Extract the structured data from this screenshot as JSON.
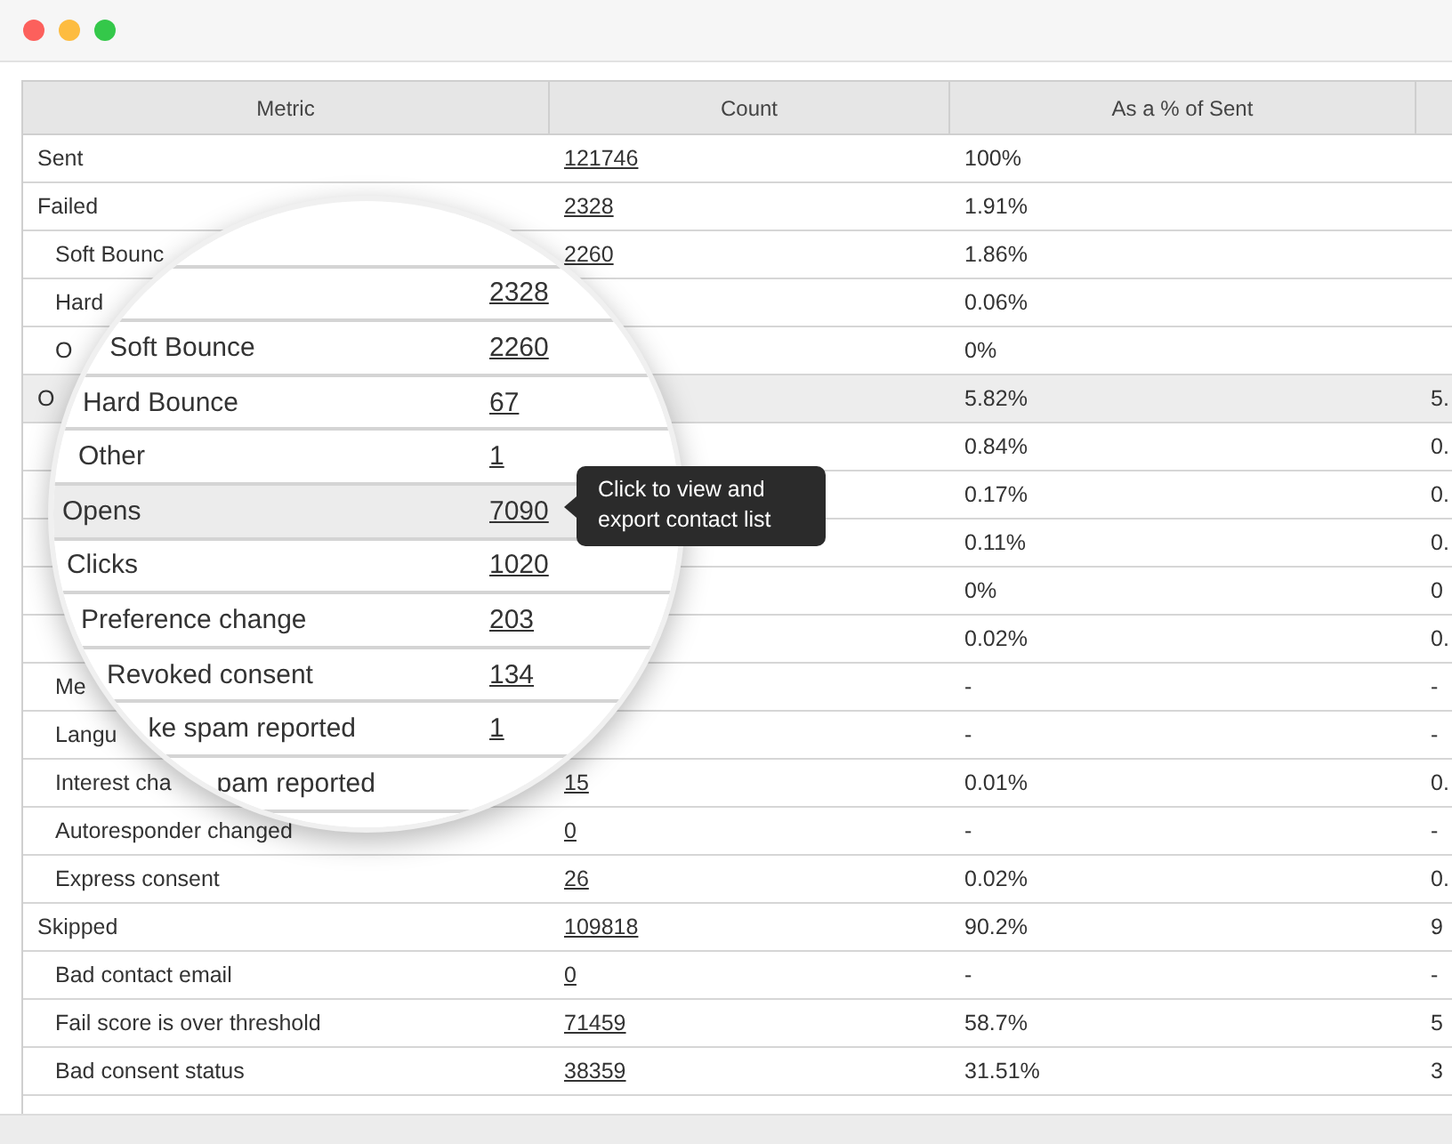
{
  "table": {
    "columns": [
      "Metric",
      "Count",
      "As a % of Sent"
    ],
    "rows": [
      {
        "kind": "group",
        "highlighted": false,
        "metric": "Sent",
        "count": "121746",
        "percent": "100%"
      },
      {
        "kind": "group",
        "highlighted": false,
        "metric": "Failed",
        "count": "2328",
        "percent": "1.91%"
      },
      {
        "kind": "sub",
        "highlighted": false,
        "metric": "Soft Bounc",
        "count": "2260",
        "percent": "1.86%"
      },
      {
        "kind": "sub",
        "highlighted": false,
        "metric": "Hard",
        "percent": "0.06%"
      },
      {
        "kind": "sub",
        "highlighted": false,
        "metric": "O",
        "percent": "0%"
      },
      {
        "kind": "group",
        "highlighted": true,
        "metric": "O",
        "percent": "5.82%",
        "column_4": "5."
      },
      {
        "kind": "group",
        "highlighted": false,
        "percent": "0.84%",
        "column_4": "0."
      },
      {
        "kind": "group",
        "highlighted": false,
        "percent": "0.17%",
        "column_4": "0."
      },
      {
        "kind": "group",
        "highlighted": false,
        "percent": "0.11%",
        "column_4": "0."
      },
      {
        "kind": "group",
        "highlighted": false,
        "percent": "0%",
        "column_4": "0"
      },
      {
        "kind": "group",
        "highlighted": false,
        "percent": "0.02%",
        "column_4": "0."
      },
      {
        "kind": "sub",
        "highlighted": false,
        "metric": "Me",
        "percent": "-",
        "column_4": "-"
      },
      {
        "kind": "sub",
        "highlighted": false,
        "metric": "Langu",
        "percent": "-",
        "column_4": "-"
      },
      {
        "kind": "sub",
        "highlighted": false,
        "metric": "Interest cha",
        "count": "15",
        "percent": "0.01%",
        "column_4": "0."
      },
      {
        "kind": "sub",
        "highlighted": false,
        "metric": "Autoresponder changed",
        "count": "0",
        "percent": "-",
        "column_4": "-"
      },
      {
        "kind": "sub",
        "highlighted": false,
        "metric": "Express consent",
        "count": "26",
        "percent": "0.02%",
        "column_4": "0."
      },
      {
        "kind": "group",
        "highlighted": false,
        "metric": "Skipped",
        "count": "109818",
        "percent": "90.2%",
        "column_4": "9"
      },
      {
        "kind": "sub",
        "highlighted": false,
        "metric": "Bad contact email",
        "count": "0",
        "percent": "-",
        "column_4": "-"
      },
      {
        "kind": "sub",
        "highlighted": false,
        "metric": "Fail score is over threshold",
        "count": "71459",
        "percent": "58.7%",
        "column_4": "5"
      },
      {
        "kind": "sub",
        "highlighted": false,
        "metric": "Bad consent status",
        "count": "38359",
        "percent": "31.51%",
        "column_4": "3"
      }
    ]
  },
  "magnifier": {
    "rows": [
      {
        "kind": "group",
        "highlighted": false,
        "count": "2328"
      },
      {
        "kind": "sub",
        "highlighted": false,
        "metric": "Soft Bounce",
        "count": "2260"
      },
      {
        "kind": "sub",
        "highlighted": false,
        "metric": "Hard Bounce",
        "count": "67"
      },
      {
        "kind": "sub",
        "highlighted": false,
        "metric": "Other",
        "count": "1"
      },
      {
        "kind": "group",
        "highlighted": true,
        "metric": "Opens",
        "count": "7090"
      },
      {
        "kind": "group",
        "highlighted": false,
        "metric": "Clicks",
        "count": "1020"
      },
      {
        "kind": "group",
        "highlighted": false,
        "metric": "Preference change",
        "count": "203"
      },
      {
        "kind": "sub",
        "highlighted": false,
        "metric": "Revoked consent",
        "count": "134"
      },
      {
        "kind": "sub",
        "highlighted": false,
        "metric": "ke spam reported",
        "count": "1"
      },
      {
        "kind": "sub",
        "highlighted": false,
        "metric": "pam reported"
      }
    ]
  },
  "tooltip": {
    "text": "Click to view and export contact list"
  }
}
